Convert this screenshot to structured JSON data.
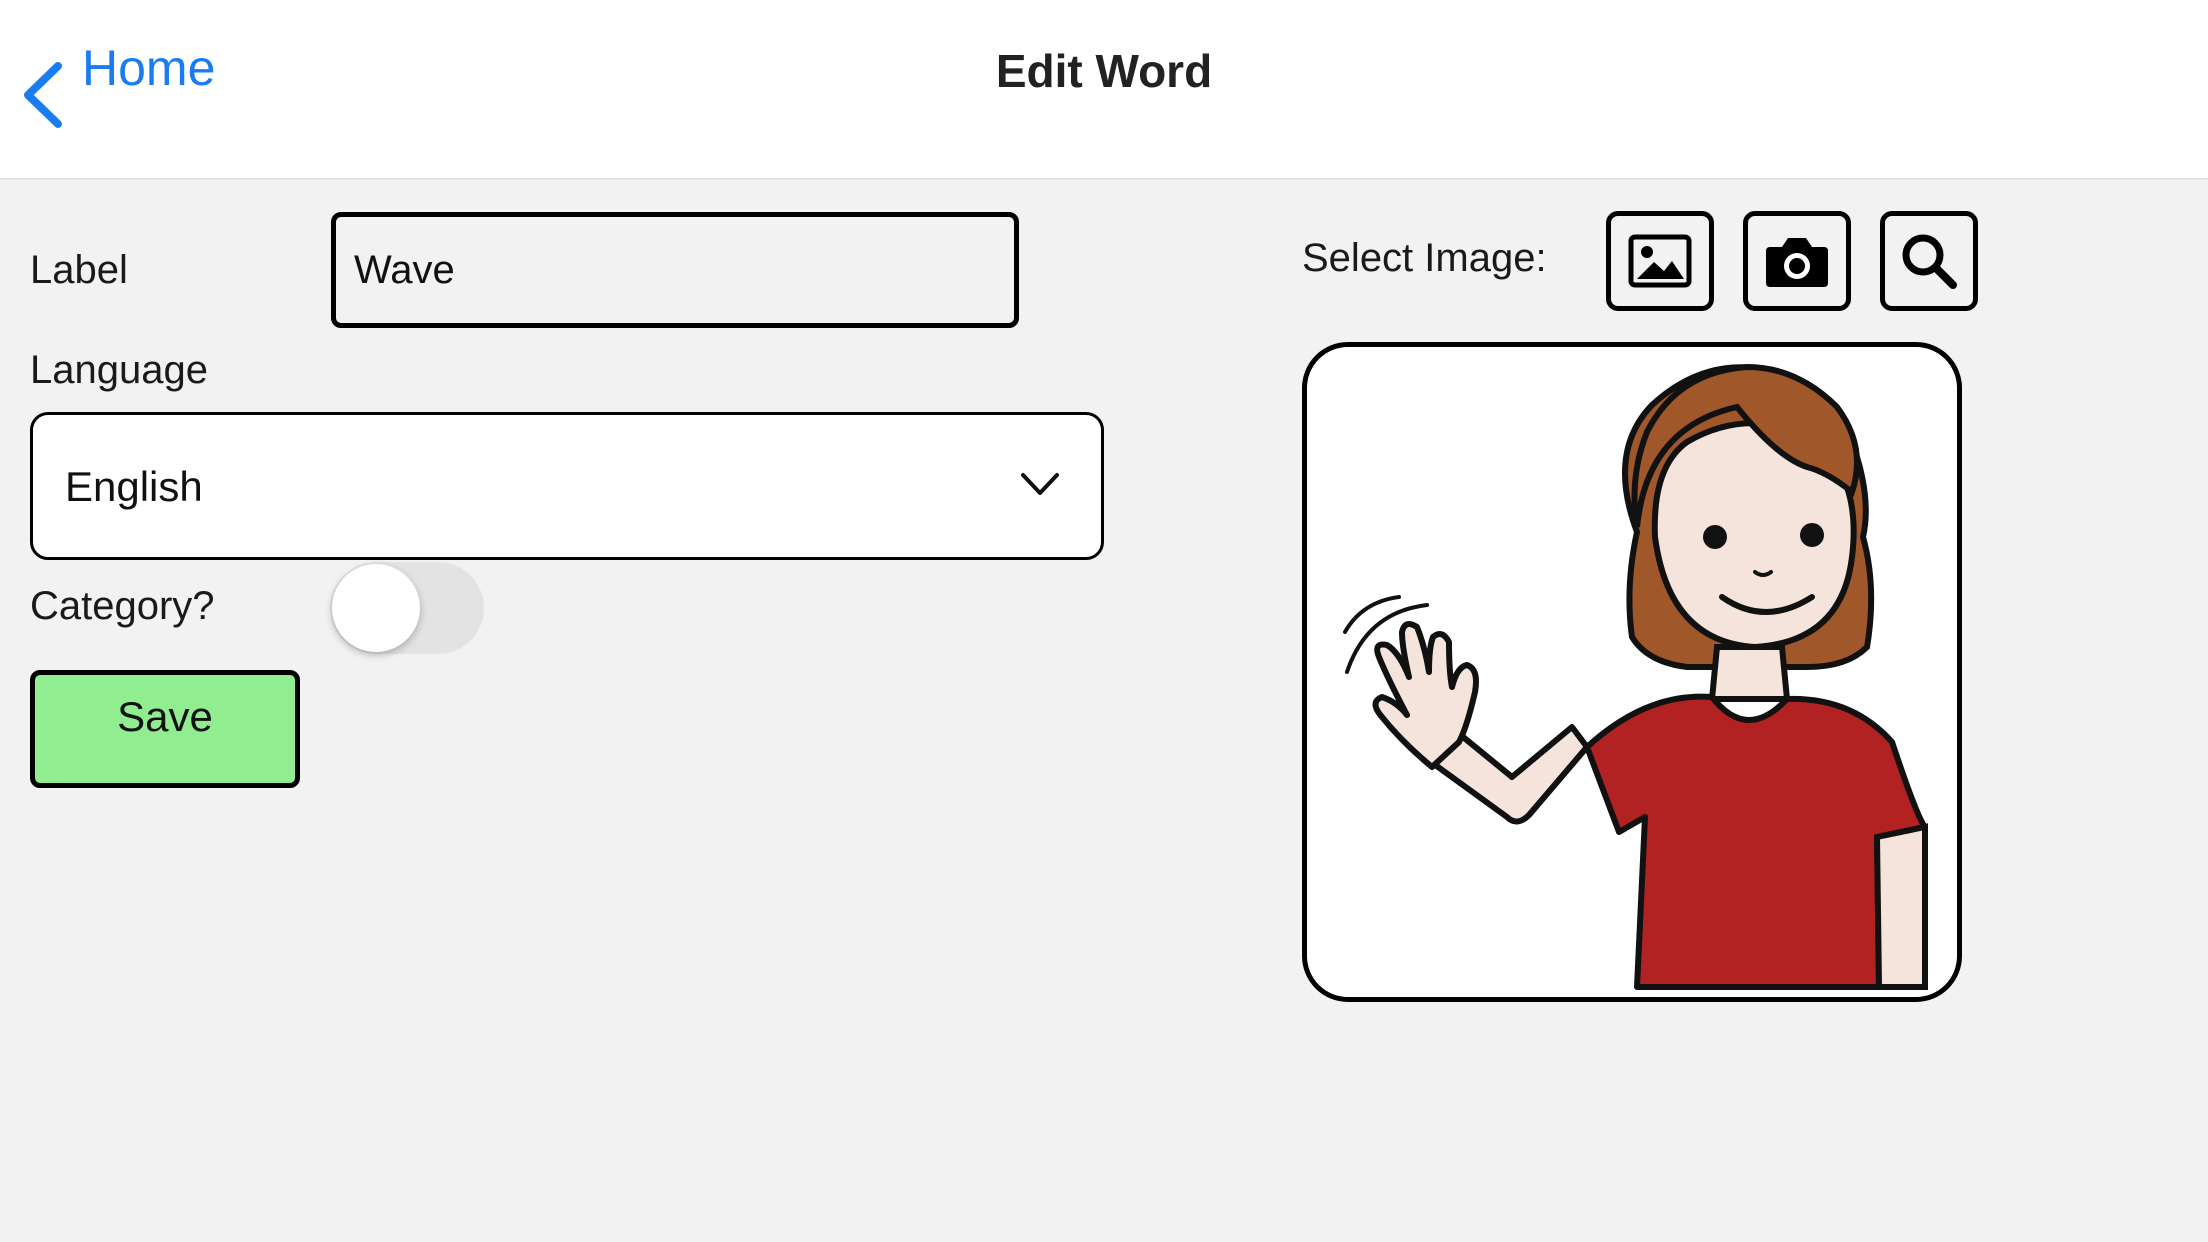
{
  "navbar": {
    "back_label": "Home",
    "title": "Edit Word"
  },
  "form": {
    "label_field_label": "Label",
    "label_value": "Wave",
    "language_field_label": "Language",
    "language_value": "English",
    "category_label": "Category?",
    "category_enabled": false,
    "save_label": "Save"
  },
  "image_panel": {
    "select_label": "Select Image:",
    "buttons": [
      "gallery-icon",
      "camera-icon",
      "search-icon"
    ],
    "picture": "person-waving-illustration"
  },
  "colors": {
    "accent": "#1a7cf2",
    "save_bg": "#90ee90",
    "page_bg": "#f2f2f2",
    "shirt": "#b22222",
    "hair": "#a0582a",
    "skin": "#f5e4dc"
  }
}
